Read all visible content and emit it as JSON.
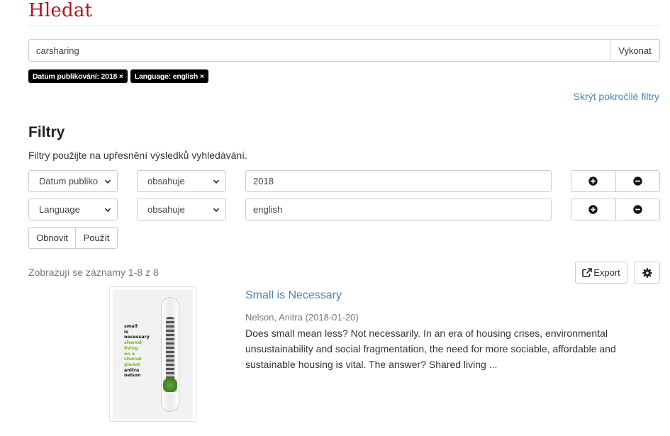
{
  "page": {
    "title": "Hledat"
  },
  "search": {
    "value": "carsharing",
    "submit_label": "Vykonat"
  },
  "active_filters": [
    "Datum publikování: 2018 ×",
    "Language: english ×"
  ],
  "advanced_filters_toggle": "Skrýt pokročilé filtry",
  "filters": {
    "heading": "Filtry",
    "description": "Filtry použijte na upřesnění výsledků vyhledávání.",
    "rows": [
      {
        "field": "Datum publiko",
        "operator": "obsahuje",
        "value": "2018"
      },
      {
        "field": "Language",
        "operator": "obsahuje",
        "value": "english"
      }
    ],
    "reset_label": "Obnovit",
    "apply_label": "Použít"
  },
  "results": {
    "count_text": "Zobrazují se záznamy 1-8 z 8",
    "export_label": "Export",
    "items": [
      {
        "title": "Small is Necessary",
        "meta": "Nelson, Anitra (2018-01-20)",
        "description": "Does small mean less? Not necessarily. In an era of housing crises, environmental unsustainability and social fragmentation, the need for more sociable, affordable and sustainable housing is vital. The answer? Shared living ...",
        "cover_lines": [
          "small",
          "is",
          "necessary"
        ],
        "cover_green_lines": [
          "shared",
          "living",
          "on a",
          "shared",
          "planet"
        ],
        "cover_author_lines": [
          "anitra",
          "nelson"
        ]
      }
    ]
  },
  "colors": {
    "brand_title": "#b3121f",
    "link": "#4a86b8",
    "chip_bg": "#000000"
  },
  "icons": {
    "add_filter": "plus-circle-icon",
    "remove_filter": "minus-circle-icon",
    "dropdown": "chevron-down-icon",
    "export": "external-link-icon",
    "settings": "gear-icon"
  }
}
